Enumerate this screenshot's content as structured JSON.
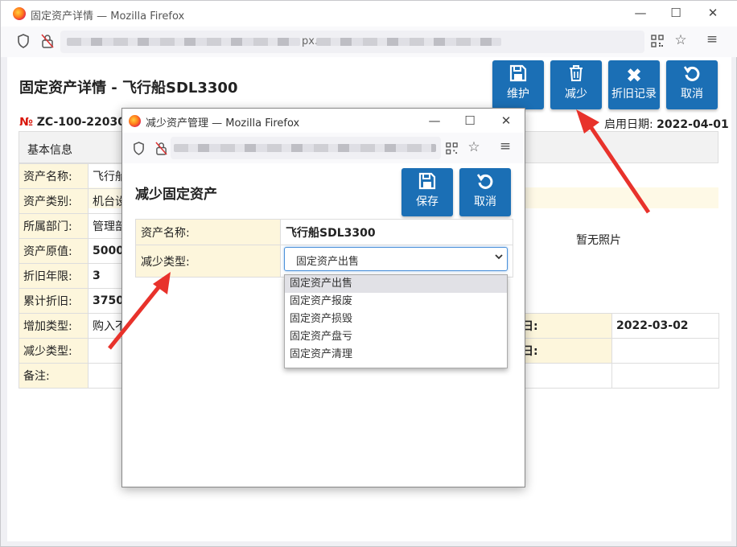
{
  "outer_window": {
    "title": "固定资产详情 — Mozilla Firefox",
    "controls": {
      "minimize": "—",
      "maximize": "☐",
      "close": "✕"
    },
    "url_suffix": "px."
  },
  "page": {
    "title": "固定资产详情 - 飞行船SDL3300",
    "toolbar": [
      {
        "icon": "save-icon",
        "label": "维护"
      },
      {
        "icon": "trash-icon",
        "label": "减少"
      },
      {
        "icon": "x-icon",
        "label": "折旧记录"
      },
      {
        "icon": "undo-icon",
        "label": "取消"
      }
    ],
    "number_symbol": "№",
    "number_value": "ZC-100-2203020",
    "date_label": "启用日期:",
    "date_value": "2022-04-01",
    "tab_label": "基本信息",
    "rows": [
      {
        "label": "资产名称:",
        "value": "飞行船"
      },
      {
        "label": "资产类别:",
        "value": "机台设"
      },
      {
        "label": "所属部门:",
        "value": "管理部"
      },
      {
        "label": "资产原值:",
        "value": "50000"
      },
      {
        "label": "折旧年限:",
        "value": "3"
      },
      {
        "label": "累计折旧:",
        "value": "3750."
      },
      {
        "label": "增加类型:",
        "value": "购入不"
      },
      {
        "label": "减少类型:",
        "value": ""
      },
      {
        "label": "备注:",
        "value": ""
      }
    ],
    "photo_text": "暂无照片",
    "right_label_1": "日:",
    "right_value_1": "2022-03-02",
    "right_label_2": "日:"
  },
  "popup": {
    "title": "减少资产管理 — Mozilla Firefox",
    "controls": {
      "minimize": "—",
      "maximize": "☐",
      "close": "✕"
    },
    "heading": "减少固定资产",
    "buttons": [
      {
        "icon": "save-icon",
        "label": "保存"
      },
      {
        "icon": "undo-icon",
        "label": "取消"
      }
    ],
    "fields": [
      {
        "label": "资产名称:",
        "value": "飞行船SDL3300"
      },
      {
        "label": "减少类型:",
        "value": "固定资产出售"
      }
    ],
    "dropdown_options": [
      "固定资产出售",
      "固定资产报废",
      "固定资产损毁",
      "固定资产盘亏",
      "固定资产清理"
    ],
    "dropdown_selected": "固定资产出售"
  },
  "colors": {
    "primary_button": "#1b6fb5",
    "label_bg": "#fdf6dc",
    "arrow": "#e8322b",
    "number_symbol": "#d9160b"
  }
}
